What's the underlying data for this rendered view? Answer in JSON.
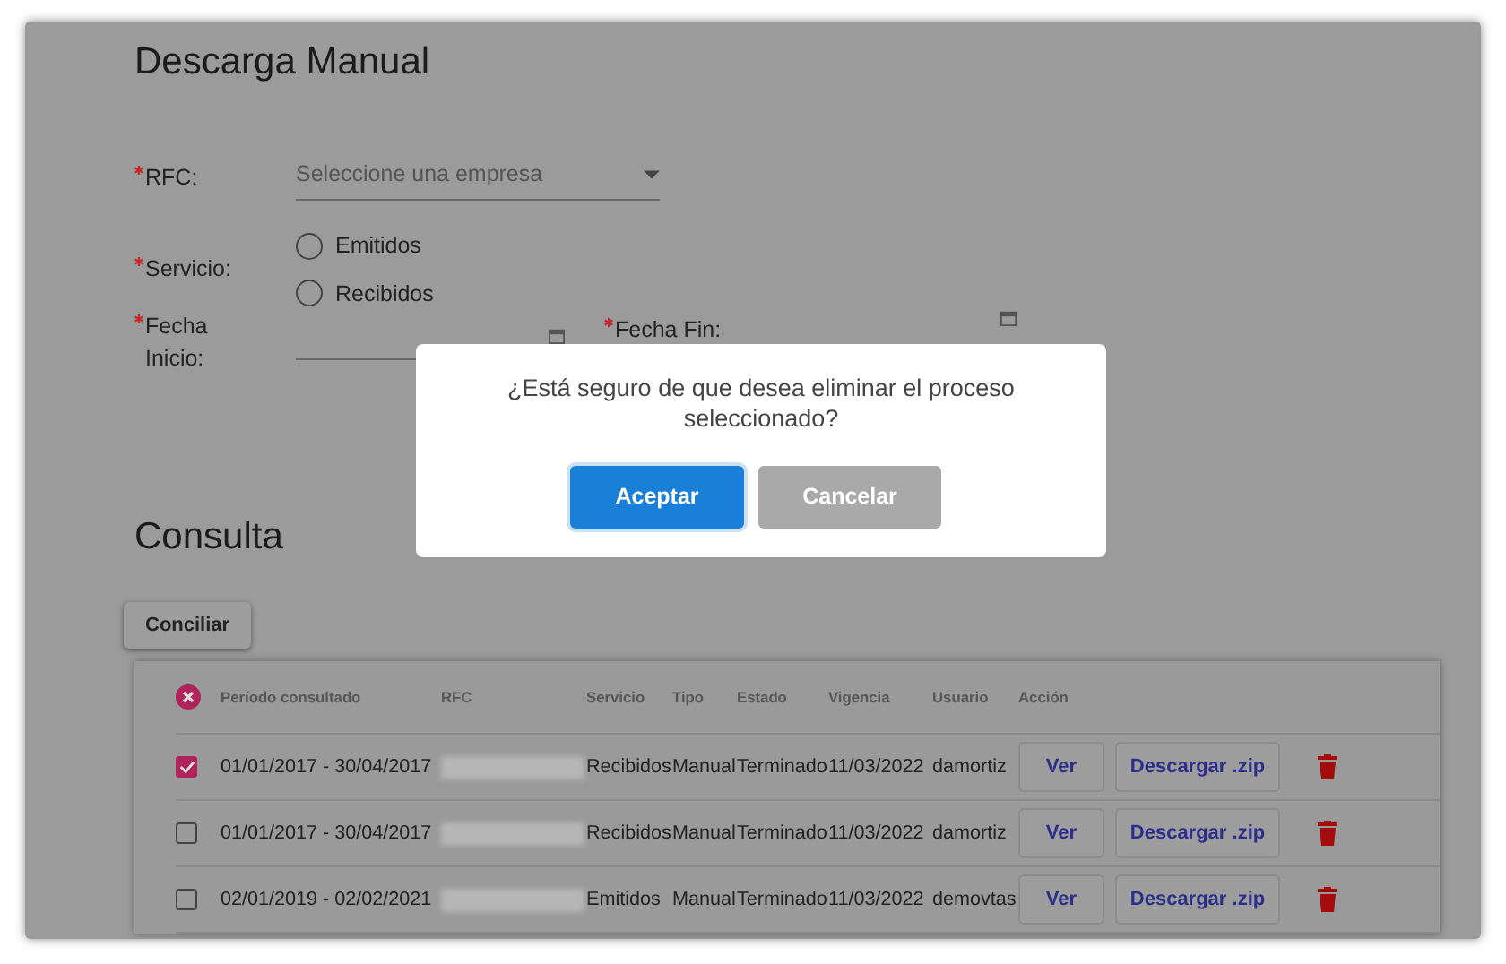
{
  "page": {
    "title": "Descarga Manual"
  },
  "form": {
    "rfc": {
      "label": "RFC:",
      "required": true,
      "placeholder": "Seleccione una empresa"
    },
    "servicio": {
      "label": "Servicio:",
      "required": true,
      "options": [
        {
          "label": "Emitidos",
          "selected": false
        },
        {
          "label": "Recibidos",
          "selected": false
        }
      ]
    },
    "fecha_inicio": {
      "label": "Fecha Inicio:",
      "required": true
    },
    "fecha_fin": {
      "label": "Fecha Fin:",
      "required": true
    }
  },
  "consulta": {
    "title": "Consulta",
    "button": "Conciliar"
  },
  "table": {
    "columns": [
      "Período consultado",
      "RFC",
      "Servicio",
      "Tipo",
      "Estado",
      "Vigencia",
      "Usuario",
      "Acción"
    ],
    "rows": [
      {
        "selected": true,
        "periodo": "01/01/2017 - 30/04/2017",
        "servicio": "Recibidos",
        "tipo": "Manual",
        "estado": "Terminado",
        "vigencia": "11/03/2022",
        "usuario": "damortiz",
        "actions": [
          "Ver",
          "Descargar .zip"
        ]
      },
      {
        "selected": false,
        "periodo": "01/01/2017 - 30/04/2017",
        "servicio": "Recibidos",
        "tipo": "Manual",
        "estado": "Terminado",
        "vigencia": "11/03/2022",
        "usuario": "damortiz",
        "actions": [
          "Ver",
          "Descargar .zip"
        ]
      },
      {
        "selected": false,
        "periodo": "02/01/2019 - 02/02/2021",
        "servicio": "Emitidos",
        "tipo": "Manual",
        "estado": "Terminado",
        "vigencia": "11/03/2022",
        "usuario": "demovtas",
        "actions": [
          "Ver",
          "Descargar .zip"
        ]
      }
    ]
  },
  "dialog": {
    "message": "¿Está seguro de que desea eliminar el proceso seleccionado?",
    "buttons": [
      {
        "label": "Aceptar",
        "kind": "primary"
      },
      {
        "label": "Cancelar",
        "kind": "secondary"
      }
    ]
  }
}
